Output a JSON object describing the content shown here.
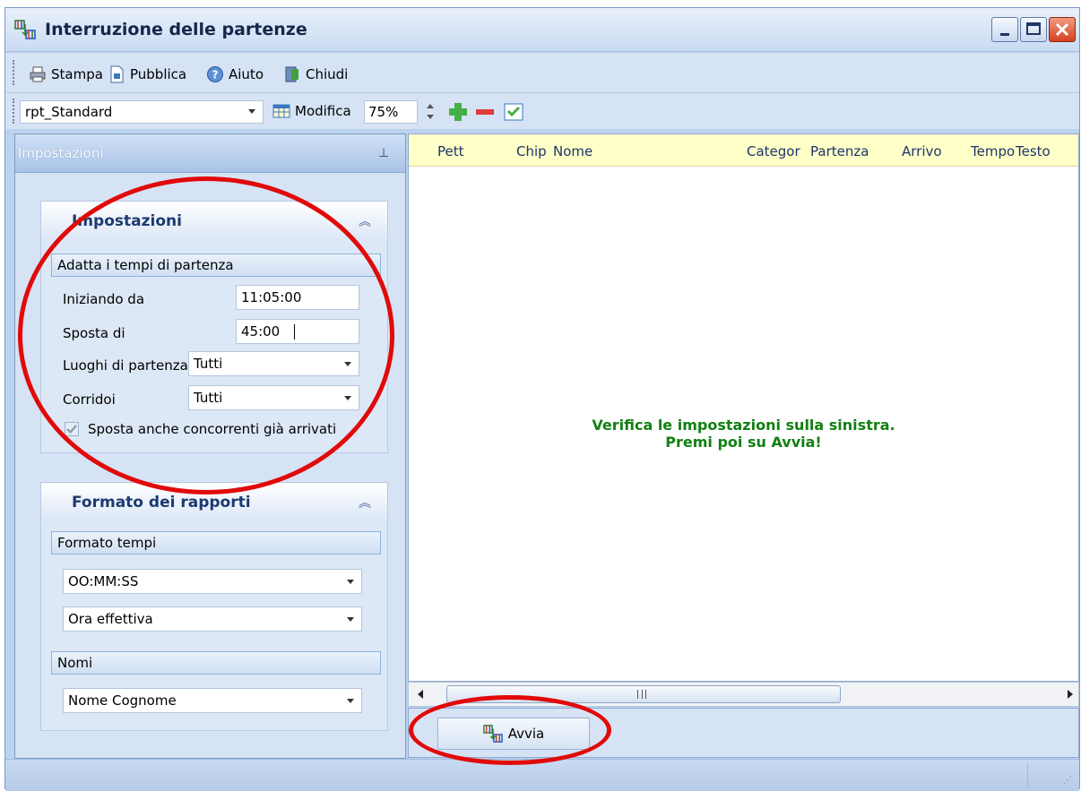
{
  "window": {
    "title": "Interruzione delle partenze"
  },
  "toolbar": {
    "print_label": "Stampa",
    "publish_label": "Pubblica",
    "help_label": "Aiuto",
    "close_label": "Chiudi",
    "report_value": "rpt_Standard",
    "edit_label": "Modifica",
    "zoom_value": "75%"
  },
  "left_panel": {
    "header": "Impostazioni",
    "settings_group": {
      "title": "Impostazioni",
      "subhead": "Adatta i tempi di partenza",
      "start_from_label": "Iniziando da",
      "start_from_value": "11:05:00",
      "shift_by_label": "Sposta di",
      "shift_by_value": "45:00",
      "start_places_label": "Luoghi di partenza",
      "start_places_value": "Tutti",
      "corridors_label": "Corridoi",
      "corridors_value": "Tutti",
      "shift_arrived_label": "Sposta anche concorrenti già arrivati",
      "shift_arrived_checked": true
    },
    "report_group": {
      "title": "Formato dei rapporti",
      "time_format_subhead": "Formato tempi",
      "time_format_value": "OO:MM:SS",
      "time_type_value": "Ora effettiva",
      "names_subhead": "Nomi",
      "names_value": "Nome Cognome"
    }
  },
  "grid": {
    "columns": [
      "Pett",
      "Chip",
      "Nome",
      "Categor",
      "Partenza",
      "Arrivo",
      "Tempo",
      "Testo"
    ],
    "message_line1": "Verifica le impostazioni sulla sinistra.",
    "message_line2": "Premi poi su Avvia!"
  },
  "actions": {
    "start_label": "Avvia"
  },
  "colors": {
    "accent": "#1b3a70",
    "message": "#128012",
    "annotation": "#e10a0a"
  }
}
